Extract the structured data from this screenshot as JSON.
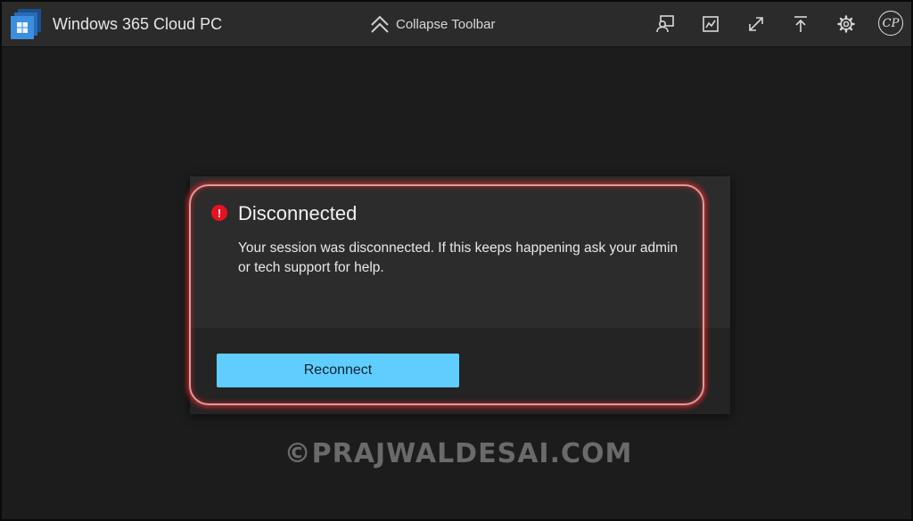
{
  "toolbar": {
    "app_title": "Windows 365 Cloud PC",
    "collapse_label": "Collapse Toolbar",
    "icons": [
      "remote-session-icon",
      "screen-icon",
      "fullscreen-expand-icon",
      "upload-icon",
      "gear-icon"
    ],
    "avatar_initials": "CP"
  },
  "dialog": {
    "title": "Disconnected",
    "status_icon": "!",
    "message": "Your session was disconnected. If this keeps happening ask your admin or tech support for help.",
    "reconnect_label": "Reconnect"
  },
  "watermark": {
    "text": "©PRAJWALDESAI.COM"
  },
  "colors": {
    "toolbar_bg": "#2b2b2b",
    "page_bg": "#1c1c1c",
    "dialog_bg": "#2c2c2c",
    "accent": "#60cdff",
    "error": "#e81123",
    "highlight": "#e02828"
  }
}
